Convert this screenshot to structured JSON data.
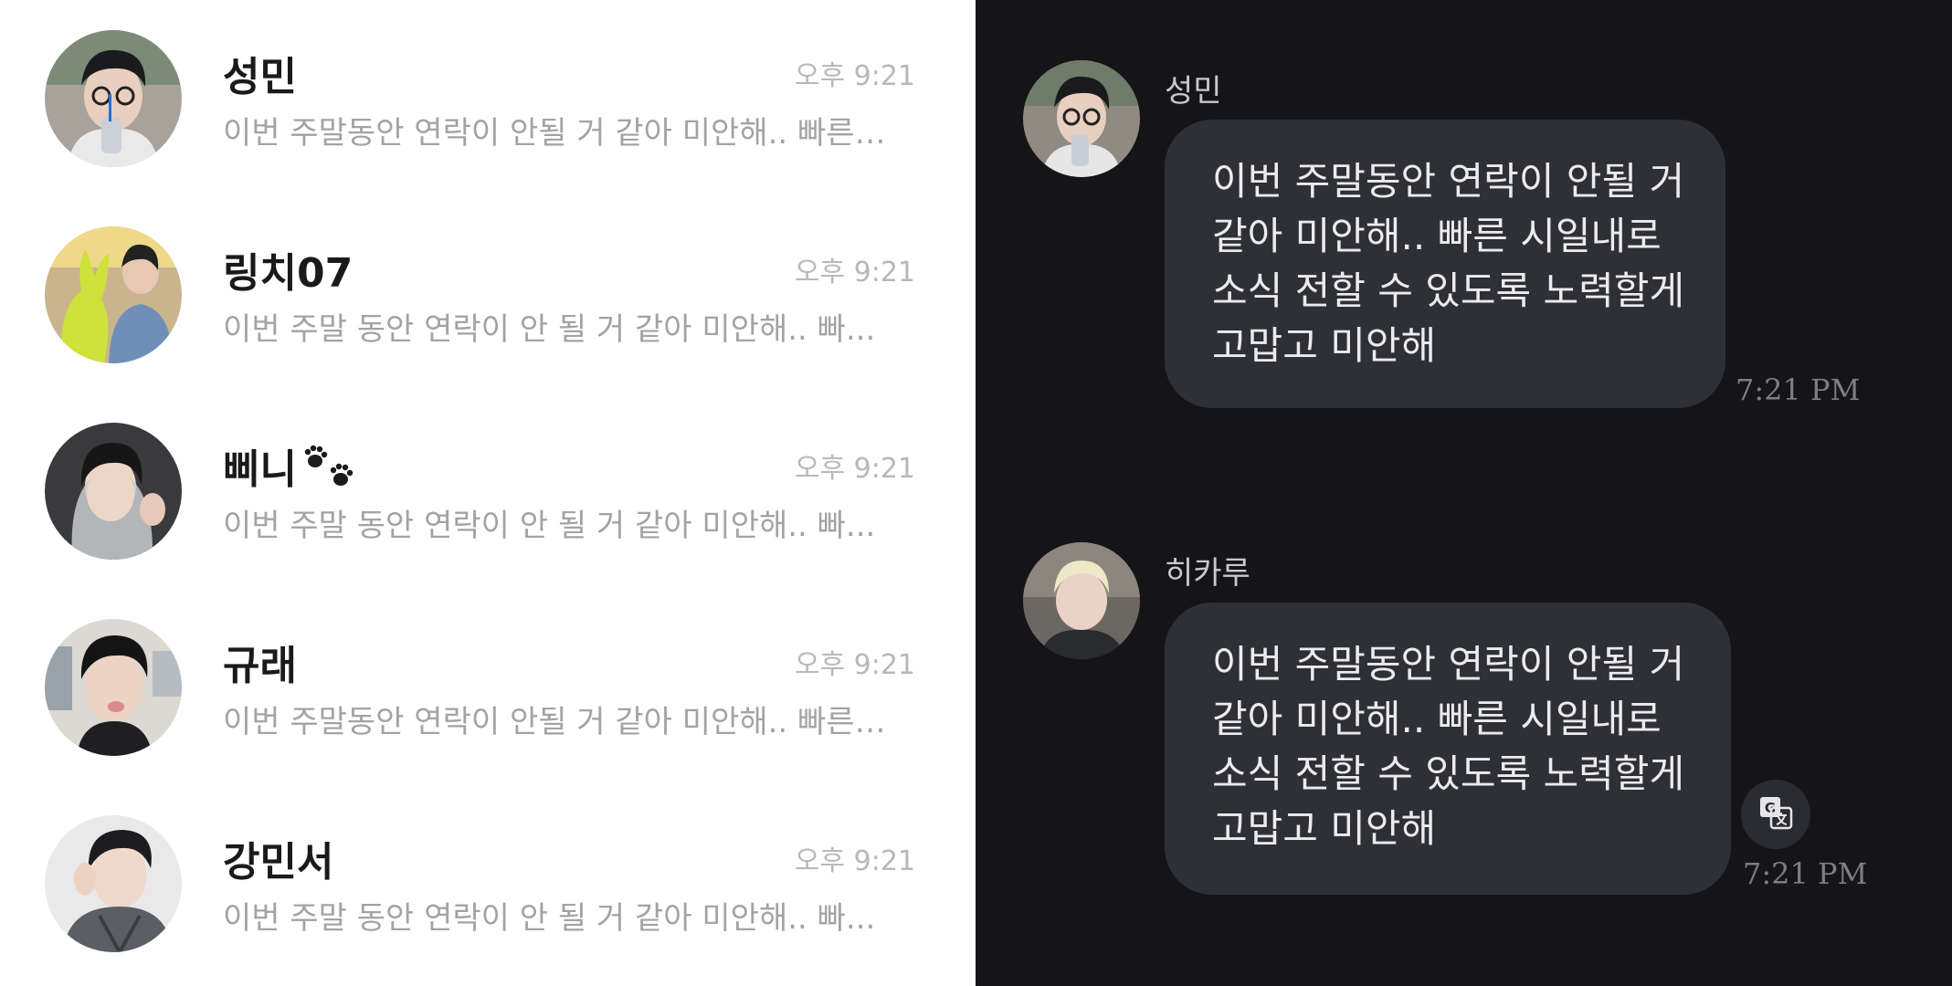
{
  "chat_list": {
    "items": [
      {
        "name": "성민",
        "time": "오후 9:21",
        "preview": "이번 주말동안 연락이 안될 거 같아 미안해.. 빠른…"
      },
      {
        "name": "링치07",
        "time": "오후 9:21",
        "preview": "이번 주말 동안 연락이 안 될 거 같아 미안해.. 빠..."
      },
      {
        "name": "삐니",
        "time": "오후 9:21",
        "preview": "이번 주말 동안 연락이 안 될 거 같아 미안해.. 빠..."
      },
      {
        "name": "규래",
        "time": "오후 9:21",
        "preview": "이번 주말동안 연락이 안될 거 같아 미안해.. 빠른…"
      },
      {
        "name": "강민서",
        "time": "오후 9:21",
        "preview": "이번 주말 동안 연락이 안 될 거 같아 미안해.. 빠..."
      }
    ]
  },
  "chat_view": {
    "messages": [
      {
        "sender": "성민",
        "lines": [
          "이번 주말동안 연락이 안될 거",
          "같아 미안해.. 빠른 시일내로",
          "소식 전할 수 있도록 노력할게",
          "고맙고 미안해"
        ],
        "time": "7:21 PM"
      },
      {
        "sender": "히카루",
        "lines": [
          "이번 주말동안 연락이 안될 거",
          "같아 미안해.. 빠른 시일내로",
          "소식 전할 수 있도록 노력할게",
          "고맙고 미안해"
        ],
        "time": "7:21 PM"
      }
    ]
  },
  "icons": {
    "paw": "paw-prints-icon",
    "translate": "translate-icon"
  },
  "colors": {
    "list_bg": "#ffffff",
    "chat_bg": "#151518",
    "bubble_bg": "#2f3036",
    "name_text": "#1a1a1a",
    "preview_text": "#a3a3a3",
    "bubble_text": "#ececef"
  }
}
